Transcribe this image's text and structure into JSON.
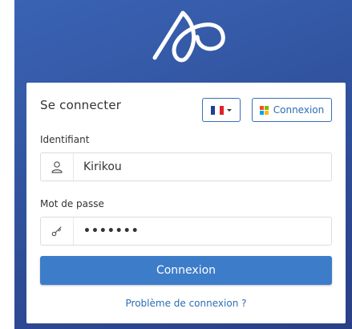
{
  "brand": {
    "accent": "#3d7cc9",
    "background": "#3a5aa8"
  },
  "login": {
    "title": "Se connecter",
    "language": {
      "selected": "fr",
      "flag_colors": [
        "#1f3f9a",
        "#ffffff",
        "#e1222b"
      ]
    },
    "microsoft_button_label": "Connexion",
    "username_label": "Identifiant",
    "username_value": "Kirikou",
    "password_label": "Mot de passe",
    "password_value": "•••••••",
    "submit_label": "Connexion",
    "help_link": "Problème de connexion ?"
  },
  "icons": {
    "logo": "app-logo",
    "user": "user-icon",
    "key": "key-icon",
    "microsoft": "microsoft-logo-icon"
  }
}
